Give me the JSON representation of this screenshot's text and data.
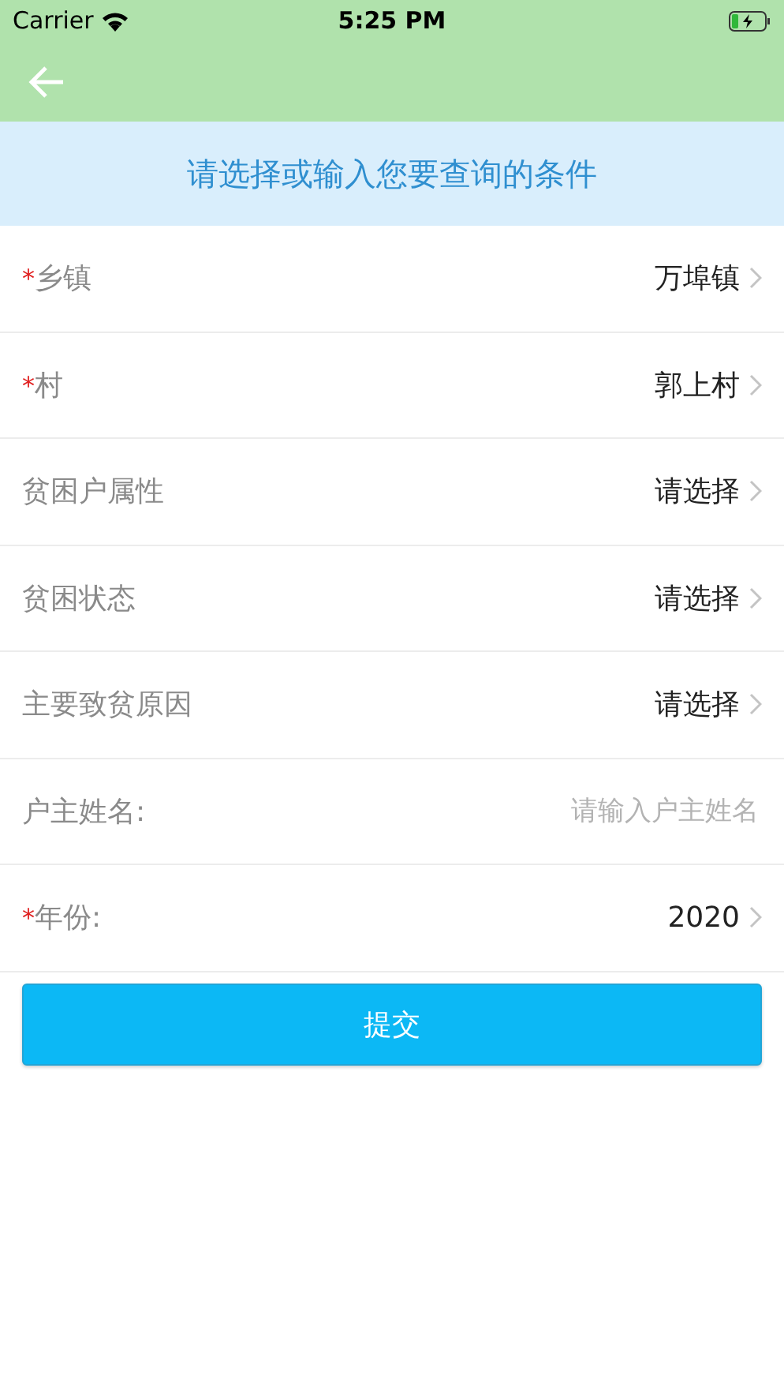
{
  "status_bar": {
    "carrier": "Carrier",
    "time": "5:25 PM"
  },
  "banner": {
    "text": "请选择或输入您要查询的条件"
  },
  "fields": [
    {
      "kind": "select",
      "required_mark": "*",
      "label": "乡镇",
      "value": "万埠镇"
    },
    {
      "kind": "select",
      "required_mark": "*",
      "label": "村",
      "value": "郭上村"
    },
    {
      "kind": "select",
      "label": "贫困户属性",
      "value": "请选择"
    },
    {
      "kind": "select",
      "label": "贫困状态",
      "value": "请选择"
    },
    {
      "kind": "select",
      "label": "主要致贫原因",
      "value": "请选择"
    },
    {
      "kind": "input",
      "label": "户主姓名:",
      "placeholder": "请输入户主姓名"
    },
    {
      "kind": "select",
      "required_mark": "*",
      "label": "年份:",
      "value": "2020"
    }
  ],
  "submit_button": {
    "label": "提交"
  }
}
